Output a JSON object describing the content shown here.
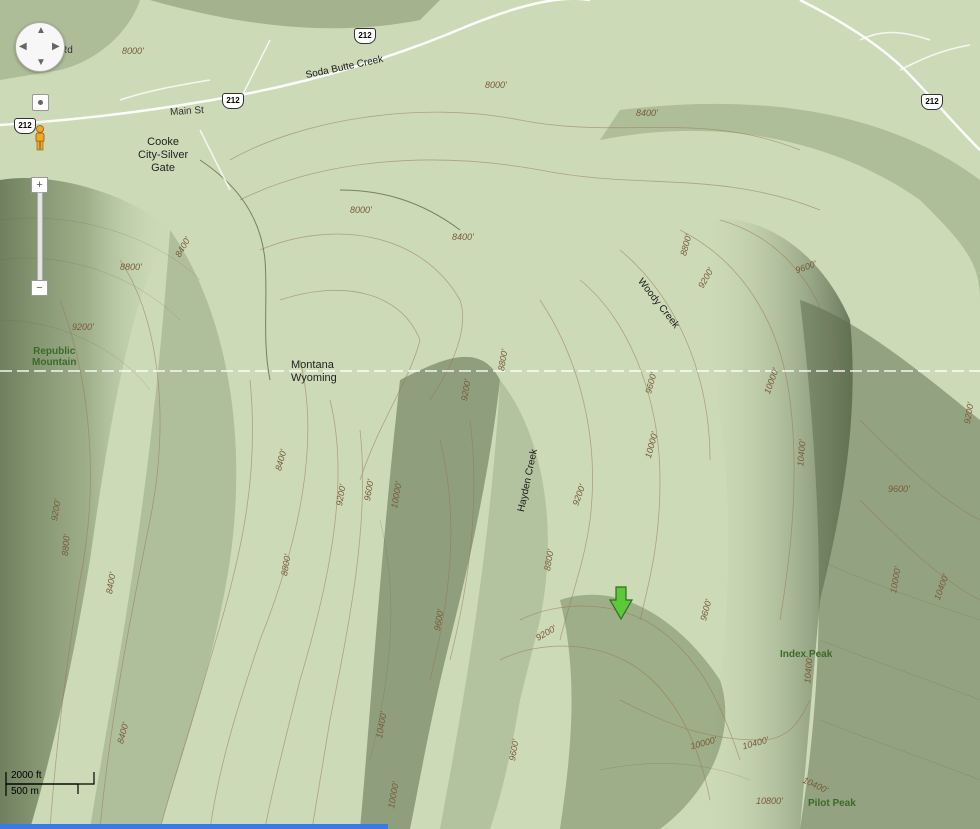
{
  "map": {
    "places": {
      "cooke_city": "Cooke\nCity-Silver\nGate",
      "montana": "Montana",
      "wyoming": "Wyoming"
    },
    "peaks": {
      "republic": "Republic\nMountain",
      "index": "Index Peak",
      "pilot": "Pilot Peak"
    },
    "creeks": {
      "soda_butte": "Soda Butte Creek",
      "woody": "Woody Creek",
      "hayden": "Hayden Creek"
    },
    "roads": {
      "main_st": "Main St",
      "rd": "Rd",
      "route": "212"
    },
    "contours": {
      "c8000": "8000'",
      "c8400": "8400'",
      "c8800": "8800'",
      "c9200": "9200'",
      "c9600": "9600'",
      "c10000": "10000'",
      "c10400": "10400'",
      "c10800": "10800'"
    },
    "colors": {
      "terrain": "#c9d8b4",
      "shadow": "#6e805c",
      "contour": "#9a7256",
      "marker": "#5cc83a",
      "boundary": "#ffffff"
    }
  },
  "controls": {
    "zoom_in": "+",
    "zoom_out": "−"
  },
  "scale": {
    "ft": "2000 ft",
    "m": "500 m"
  }
}
